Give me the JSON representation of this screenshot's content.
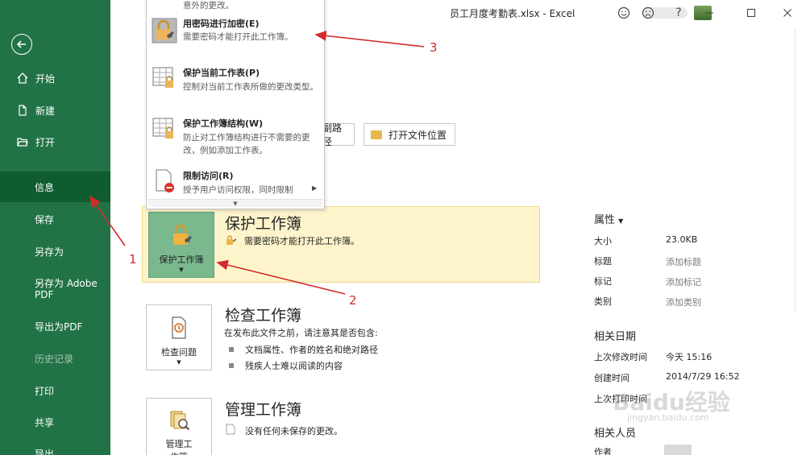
{
  "window": {
    "title": "员工月度考勤表.xlsx  -  Excel",
    "help": "?"
  },
  "sidebar": {
    "items": [
      {
        "label": "开始",
        "icon": "home-icon"
      },
      {
        "label": "新建",
        "icon": "new-doc-icon"
      },
      {
        "label": "打开",
        "icon": "open-folder-icon"
      },
      {
        "label": "信息"
      },
      {
        "label": "保存"
      },
      {
        "label": "另存为"
      },
      {
        "label": "另存为 Adobe PDF"
      },
      {
        "label": "导出为PDF"
      },
      {
        "label": "历史记录"
      },
      {
        "label": "打印"
      },
      {
        "label": "共享"
      },
      {
        "label": "导出"
      }
    ]
  },
  "toolbar": {
    "path_partial": "副路径",
    "open_location": "打开文件位置"
  },
  "menu": {
    "top_cutoff": "意外的更改。",
    "items": [
      {
        "title": "用密码进行加密(E)",
        "desc": "需要密码才能打开此工作簿。"
      },
      {
        "title": "保护当前工作表(P)",
        "desc": "控制对当前工作表所做的更改类型。"
      },
      {
        "title": "保护工作簿结构(W)",
        "desc": "防止对工作簿结构进行不需要的更改，例如添加工作表。"
      },
      {
        "title": "限制访问(R)",
        "desc": "授予用户访问权限，同时限制"
      }
    ]
  },
  "protect": {
    "button": "保护工作簿",
    "title": "保护工作簿",
    "desc": "需要密码才能打开此工作簿。"
  },
  "inspect": {
    "button": "检查问题",
    "title": "检查工作簿",
    "desc": "在发布此文件之前，请注意其是否包含:",
    "bullets": [
      "文档属性、作者的姓名和绝对路径",
      "残疾人士难以阅读的内容"
    ]
  },
  "manage": {
    "button_line1": "管理工",
    "button_line2": "作簿",
    "title": "管理工作簿",
    "desc": "没有任何未保存的更改。"
  },
  "properties": {
    "header": "属性",
    "rows": [
      {
        "key": "大小",
        "value": "23.0KB"
      },
      {
        "key": "标题",
        "value": "添加标题"
      },
      {
        "key": "标记",
        "value": "添加标记"
      },
      {
        "key": "类别",
        "value": "添加类别"
      }
    ],
    "dates_header": "相关日期",
    "dates": [
      {
        "key": "上次修改时间",
        "value": "今天 15:16"
      },
      {
        "key": "创建时间",
        "value": "2014/7/29 16:52"
      },
      {
        "key": "上次打印时间",
        "value": ""
      }
    ],
    "people_header": "相关人员",
    "people": [
      {
        "key": "作者",
        "value": ""
      }
    ]
  },
  "annotations": [
    "1",
    "2",
    "3"
  ],
  "watermark": {
    "main": "Baidu经验",
    "sub": "jingyan.baidu.com"
  },
  "colors": {
    "sidebar": "#217346",
    "active": "#0e5c2f",
    "highlight": "#fdf4cc",
    "annotation": "#d22b2b"
  }
}
